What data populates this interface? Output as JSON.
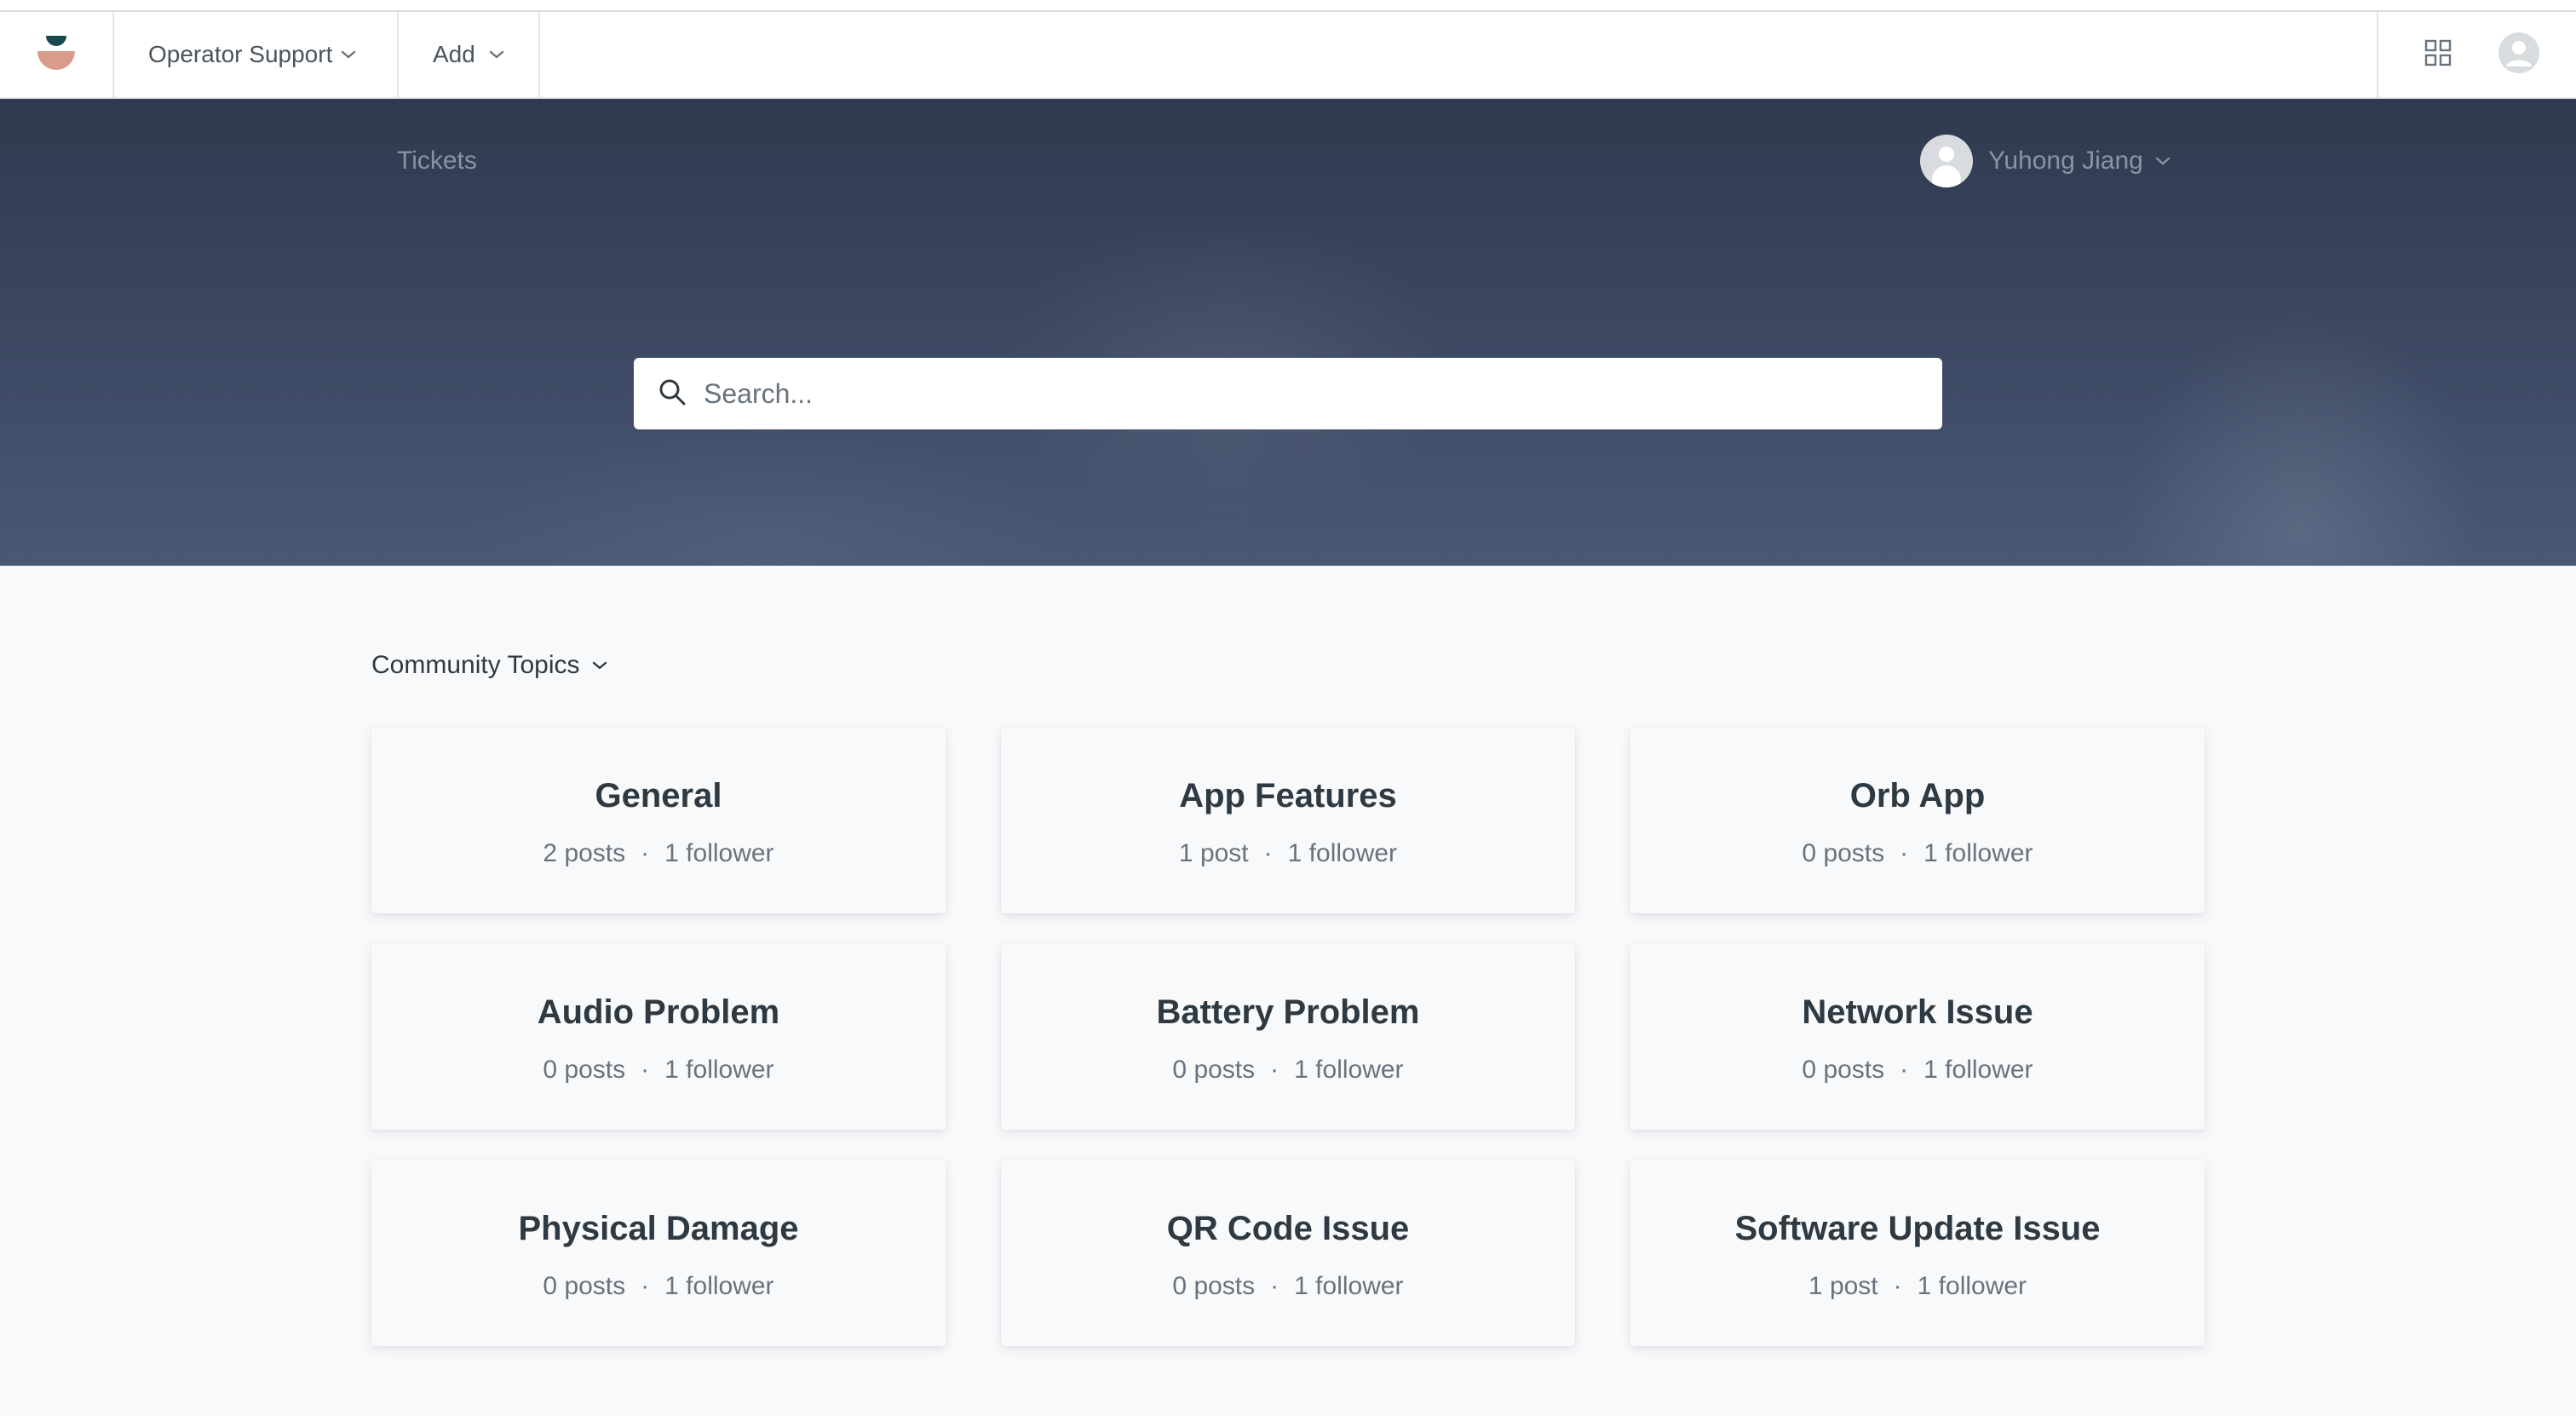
{
  "topnav": {
    "logo_icon": "support-logo-icon",
    "product_menu_label": "Operator Support",
    "add_menu_label": "Add",
    "apps_icon": "grid-icon",
    "profile_icon": "user-avatar-icon"
  },
  "hero": {
    "tickets_link": "Tickets",
    "user_name": "Yuhong Jiang",
    "search_placeholder": "Search..."
  },
  "section": {
    "title": "Community Topics"
  },
  "topics": [
    {
      "title": "General",
      "posts": "2 posts",
      "followers": "1 follower"
    },
    {
      "title": "App Features",
      "posts": "1 post",
      "followers": "1 follower"
    },
    {
      "title": "Orb App",
      "posts": "0 posts",
      "followers": "1 follower"
    },
    {
      "title": "Audio Problem",
      "posts": "0 posts",
      "followers": "1 follower"
    },
    {
      "title": "Battery Problem",
      "posts": "0 posts",
      "followers": "1 follower"
    },
    {
      "title": "Network Issue",
      "posts": "0 posts",
      "followers": "1 follower"
    },
    {
      "title": "Physical Damage",
      "posts": "0 posts",
      "followers": "1 follower"
    },
    {
      "title": "QR Code Issue",
      "posts": "0 posts",
      "followers": "1 follower"
    },
    {
      "title": "Software Update Issue",
      "posts": "1 post",
      "followers": "1 follower"
    }
  ],
  "separator": "·",
  "colors": {
    "hero_top": "#2f3a50",
    "hero_bottom": "#4a5875",
    "page_background": "#f8f9fb",
    "logo_dark": "#17494d",
    "logo_accent": "#d99b8c"
  }
}
